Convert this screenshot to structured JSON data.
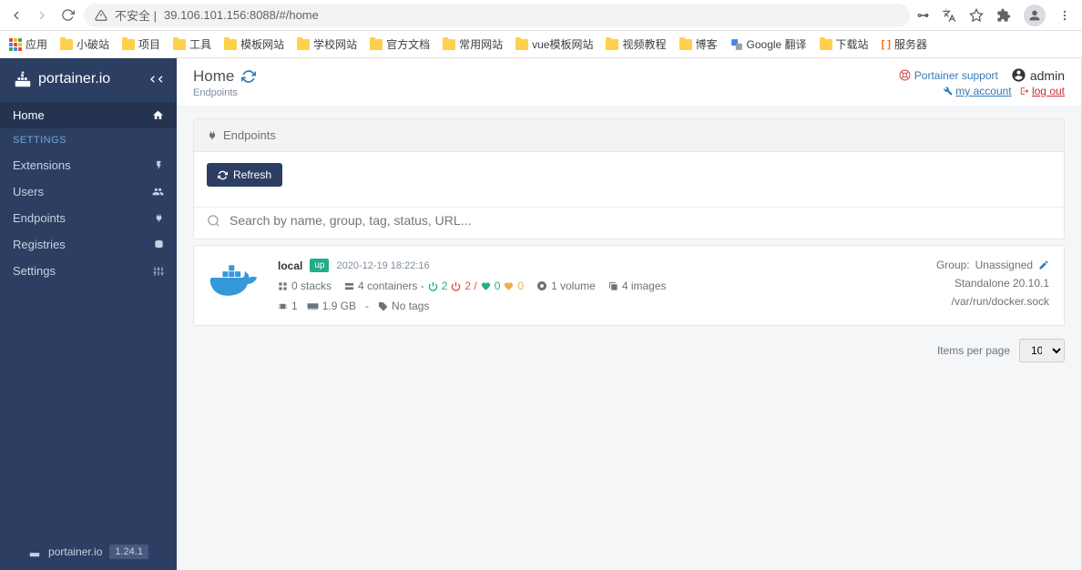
{
  "browser": {
    "url_prefix": "不安全 |",
    "url": "39.106.101.156:8088/#/home"
  },
  "bookmarks": {
    "apps": "应用",
    "items": [
      "小破站",
      "项目",
      "工具",
      "模板网站",
      "学校网站",
      "官方文档",
      "常用网站",
      "vue模板网站",
      "视频教程",
      "博客"
    ],
    "google": "Google 翻译",
    "download": "下载站",
    "server": "服务器"
  },
  "sidebar": {
    "brand": "portainer.io",
    "items": [
      {
        "label": "Home"
      }
    ],
    "settings_header": "SETTINGS",
    "settings": [
      {
        "label": "Extensions"
      },
      {
        "label": "Users"
      },
      {
        "label": "Endpoints"
      },
      {
        "label": "Registries"
      },
      {
        "label": "Settings"
      }
    ],
    "footer_brand": "portainer.io",
    "version": "1.24.1"
  },
  "header": {
    "title": "Home",
    "subtitle": "Endpoints",
    "support": "Portainer support",
    "user": "admin",
    "my_account": "my account",
    "log_out": "log out"
  },
  "panel": {
    "title": "Endpoints",
    "refresh": "Refresh",
    "search_placeholder": "Search by name, group, tag, status, URL..."
  },
  "endpoint": {
    "name": "local",
    "status": "up",
    "date": "2020-12-19 18:22:16",
    "stacks": "0 stacks",
    "containers_label": "4 containers -",
    "running": "2",
    "stopped": "2 /",
    "healthy": "0",
    "unhealthy": "0",
    "volumes": "1 volume",
    "images": "4 images",
    "cpus": "1",
    "memory": "1.9 GB",
    "dash": "-",
    "no_tags": "No tags",
    "group_label": "Group: ",
    "group_value": "Unassigned",
    "type": "Standalone 20.10.1",
    "socket": "/var/run/docker.sock"
  },
  "pager": {
    "label": "Items per page",
    "value": "10"
  }
}
